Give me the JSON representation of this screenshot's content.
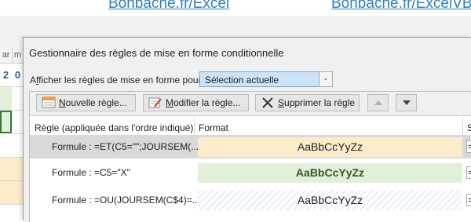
{
  "links": [
    "Bonbache.fr/Excel",
    "Bonbache.fr/ExcelVBA"
  ],
  "sheet": {
    "col_headers": [
      "ar",
      "m"
    ],
    "row_values": [
      "2",
      "0"
    ]
  },
  "dialog": {
    "title": "Gestionnaire des règles de mise en forme conditionnelle",
    "show_label": "Afficher les règles de mise en forme pour :",
    "show_value": "Sélection actuelle",
    "buttons": {
      "new_rule": "Nouvelle règle...",
      "edit_rule": "Modifier la règle...",
      "delete_rule": "Supprimer la règle"
    },
    "columns": {
      "rule": "Règle (appliquée dans l'ordre indiqué)",
      "format": "Format",
      "applies": "S"
    },
    "rules": [
      {
        "formula": "Formule : =ET(C5=\"\";JOURSEM(...",
        "preview": "AaBbCcYyZz",
        "fill": "#fdeccc",
        "text_color": "#1f1f1f"
      },
      {
        "formula": "Formule : =C5=\"X\"",
        "preview": "AaBbCcYyZz",
        "fill": "#e2efda",
        "text_color": "#375623"
      },
      {
        "formula": "Formule : =OU(JOURSEM(C$4)=...",
        "preview": "AaBbCcYyZz",
        "fill": "#f4f6fb",
        "text_color": "#1f1f1f"
      }
    ],
    "selected_rule_index": 0
  },
  "colors": {
    "link": "#2f7fc2",
    "dialog_bg": "#f0f0f0",
    "select_highlight": "#cce4f7",
    "selected_row": "#d9d9d9"
  }
}
